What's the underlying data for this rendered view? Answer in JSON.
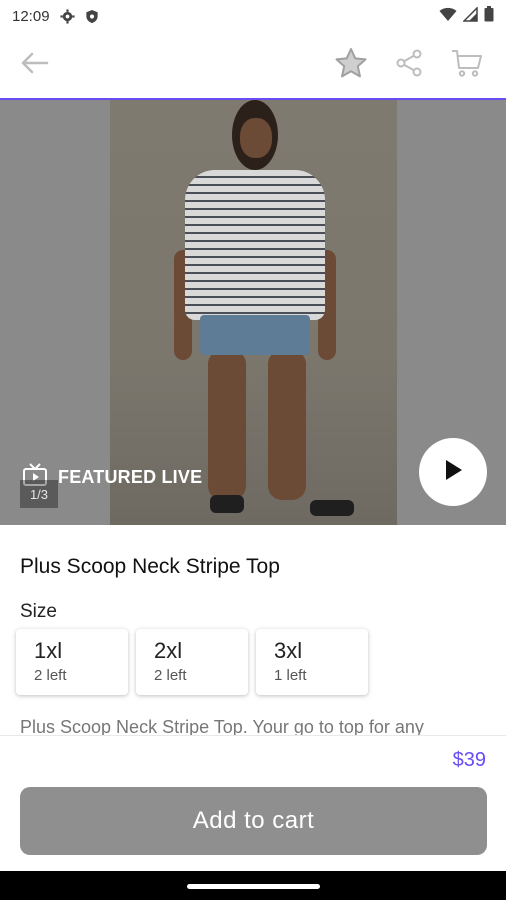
{
  "status_bar": {
    "time": "12:09",
    "icons": [
      "gear-icon",
      "shield-icon",
      "wifi-icon",
      "signal-icon",
      "battery-icon"
    ]
  },
  "app_bar": {
    "accent": "#6a4cf5",
    "icons": [
      "back-arrow-icon",
      "star-icon",
      "share-icon",
      "cart-icon"
    ]
  },
  "media": {
    "badge": "FEATURED LIVE",
    "counter": "1/3"
  },
  "product": {
    "title": "Plus Scoop Neck Stripe Top",
    "size_heading": "Size",
    "sizes": [
      {
        "size": "1xl",
        "stock": "2 left"
      },
      {
        "size": "2xl",
        "stock": "2 left"
      },
      {
        "size": "3xl",
        "stock": "1 left"
      }
    ],
    "description": "Plus Scoop Neck Stripe Top. Your go to top for any"
  },
  "footer": {
    "price": "$39",
    "add_to_cart": "Add to cart",
    "button_color": "#8f8f8f",
    "price_color": "#6a4cf5"
  }
}
